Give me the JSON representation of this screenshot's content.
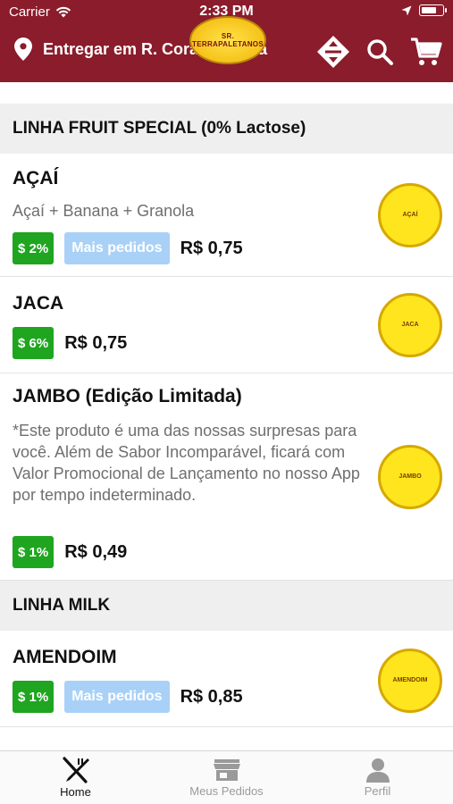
{
  "status_bar": {
    "carrier": "Carrier",
    "time": "2:33 PM"
  },
  "header": {
    "location_text": "Entregar em R. Cora Coralina",
    "logo_text": "SR. TERRAPALETANOS"
  },
  "sections": [
    {
      "title": "LINHA FRUIT SPECIAL (0% Lactose)",
      "products": [
        {
          "name": "AÇAÍ",
          "description": "Açaí + Banana + Granola",
          "discount": "$ 2%",
          "popular": "Mais pedidos",
          "price": "R$ 0,75",
          "thumb_label": "AÇAÍ"
        },
        {
          "name": "JACA",
          "discount": "$ 6%",
          "price": "R$ 0,75",
          "thumb_label": "JACA"
        },
        {
          "name": "JAMBO (Edição Limitada)",
          "description": "*Este produto é uma das nossas surpresas para você. Além de Sabor Incomparável, ficará com Valor Promocional de Lançamento no nosso App por tempo indeterminado.",
          "discount": "$ 1%",
          "price": "R$ 0,49",
          "thumb_label": "JAMBO"
        }
      ]
    },
    {
      "title": "LINHA MILK",
      "products": [
        {
          "name": "AMENDOIM",
          "discount": "$ 1%",
          "popular": "Mais pedidos",
          "price": "R$ 0,85",
          "thumb_label": "AMENDOIM"
        }
      ]
    }
  ],
  "tabs": [
    {
      "label": "Home",
      "icon": "fork-knife-icon",
      "active": true
    },
    {
      "label": "Meus Pedidos",
      "icon": "store-icon",
      "active": false
    },
    {
      "label": "Perfil",
      "icon": "person-icon",
      "active": false
    }
  ],
  "colors": {
    "header_bg": "#8a1c2b",
    "discount_green": "#1fa51f",
    "popular_blue": "#a9d1f7",
    "section_bg": "#efefef"
  }
}
